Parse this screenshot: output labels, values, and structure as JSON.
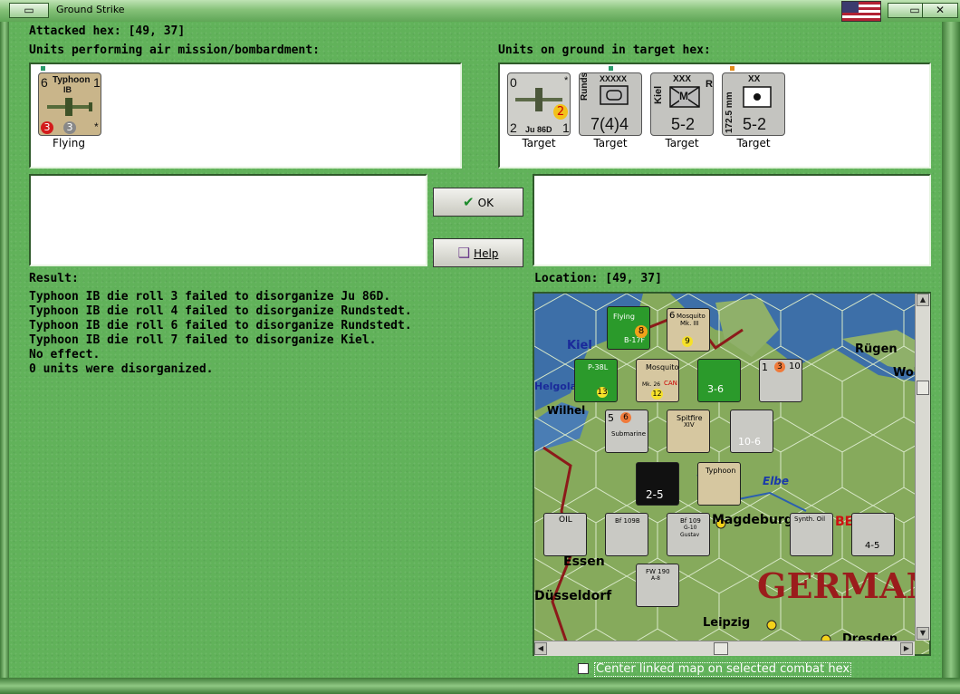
{
  "window": {
    "title": "Ground Strike"
  },
  "header": {
    "attacked_hex_label": "Attacked hex:",
    "attacked_hex_value": "[49, 37]"
  },
  "air_units": {
    "heading": "Units performing air mission/bombardment:",
    "items": [
      {
        "name": "Typhoon",
        "sub": "IB",
        "left_top": "6",
        "right_top": "1",
        "bottom_left": "3",
        "bottom_mid": "3",
        "star": "*",
        "status": "Flying",
        "bg": "#c9b58a"
      }
    ]
  },
  "ground_units": {
    "heading": "Units on ground in target hex:",
    "items": [
      {
        "kind": "aircraft",
        "top_left": "0",
        "top_right": "*",
        "mid": "2",
        "bottom_left": "2",
        "name": "Ju 86D",
        "bottom_right": "1",
        "status": "Target"
      },
      {
        "kind": "army",
        "size": "XXXXX",
        "side": "Rundstedt",
        "value": "7(4)4",
        "status": "Target"
      },
      {
        "kind": "corps",
        "size": "XXX",
        "side": "Kiel",
        "letter": "M",
        "right": "R",
        "value": "5-2",
        "status": "Target"
      },
      {
        "kind": "division",
        "size": "XX",
        "side": "172.5 mm",
        "value": "5-2",
        "status": "Target"
      }
    ]
  },
  "buttons": {
    "ok": "OK",
    "help": "Help"
  },
  "result": {
    "heading": "Result:",
    "lines": [
      "Typhoon IB die roll 3 failed to disorganize Ju 86D.",
      "Typhoon IB die roll 4 failed to disorganize Rundstedt.",
      "Typhoon IB die roll 6 failed to disorganize Rundstedt.",
      "Typhoon IB die roll 7 failed to disorganize Kiel.",
      "No effect.",
      "0 units were disorganized."
    ]
  },
  "location": {
    "label": "Location:",
    "value": "[49, 37]",
    "place_names": [
      "Kiel",
      "Rügen",
      "Wol",
      "Helgoland",
      "Wilhel",
      "Elbe",
      "Magdeburg",
      "Essen",
      "Düsseldorf",
      "Leipzig",
      "Dresden",
      "GERMAN",
      "BE"
    ],
    "counter_labels": [
      "Mosquito",
      "Mk. III",
      "P-38L",
      "Mosquito",
      "Mk. 26",
      "CAN",
      "Submarine",
      "Spitfire",
      "XIV",
      "Typhoon",
      "Bf 109B",
      "Bf 109",
      "G-10",
      "Gustav",
      "FW 190",
      "A-8",
      "OIL",
      "Synth. Oil",
      "B-17F",
      "Flying"
    ],
    "counter_values": [
      "6",
      "9",
      "3",
      "12",
      "7",
      "3-6",
      "1",
      "3",
      "10",
      "5",
      "6",
      "4",
      "2",
      "9",
      "10-6",
      "2-5",
      "3",
      "8",
      "4-5",
      "1",
      "6",
      "13",
      "0"
    ]
  },
  "footer": {
    "checkbox_label": "Center linked map on selected combat hex",
    "checked": false
  },
  "colors": {
    "background": "#61b25a",
    "accent_red": "#9b1c1c"
  }
}
